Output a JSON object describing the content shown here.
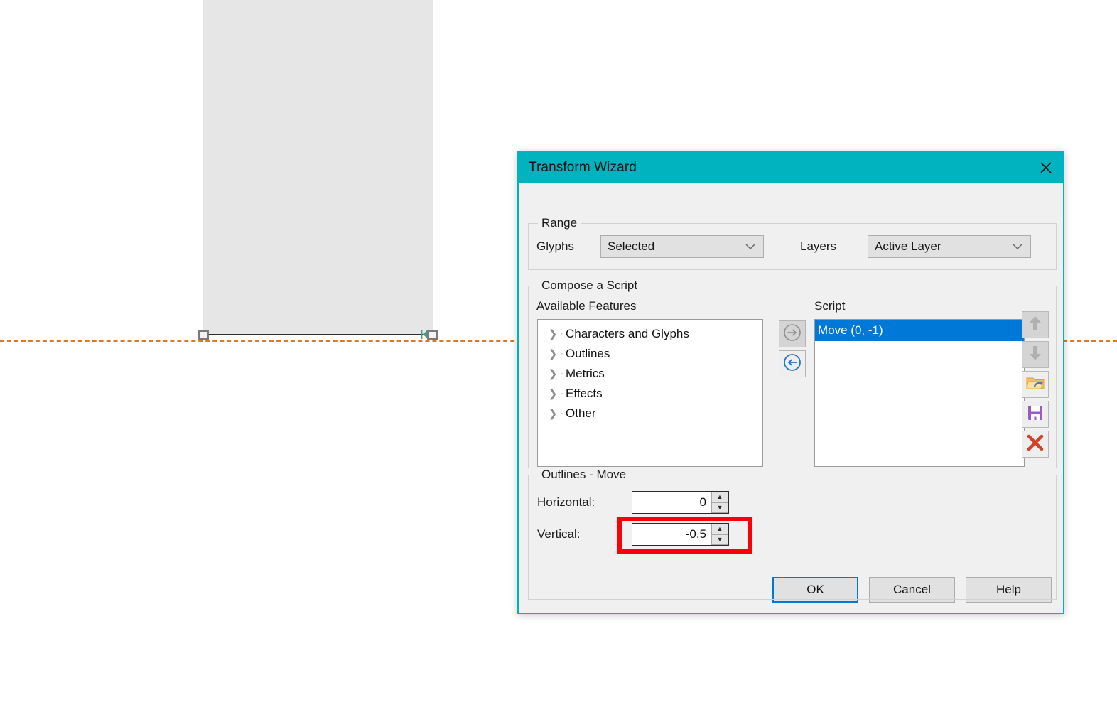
{
  "canvas": {
    "glyph_name": "glyph-outline-rectangle",
    "baseline_name": "baseline-guide",
    "nodes": [
      "node-bottom-left",
      "node-bottom-right"
    ],
    "colors": {
      "glyph_fill": "#e6e6e6",
      "glyph_stroke": "#2e2e2e",
      "baseline": "#e07820",
      "node_marker": "#4e9683"
    }
  },
  "dialog": {
    "title": "Transform Wizard",
    "close_label": "✕",
    "accent_color": "#00b3be",
    "range": {
      "group_title": "Range",
      "glyphs_label": "Glyphs",
      "glyphs_value": "Selected",
      "layers_label": "Layers",
      "layers_value": "Active Layer",
      "chevron": "⌄"
    },
    "compose": {
      "group_title": "Compose a Script",
      "available_label": "Available Features",
      "script_label": "Script",
      "features": [
        {
          "label": "Characters and Glyphs",
          "chevron": "❯"
        },
        {
          "label": "Outlines",
          "chevron": "❯"
        },
        {
          "label": "Metrics",
          "chevron": "❯"
        },
        {
          "label": "Effects",
          "chevron": "❯"
        },
        {
          "label": "Other",
          "chevron": "❯"
        }
      ],
      "script_items": [
        {
          "label": "Move (0, -1)",
          "selected": true
        }
      ],
      "transfer_right_icon": "arrow-right-circle-icon",
      "transfer_left_icon": "arrow-left-circle-icon",
      "side_buttons": [
        "move-up-icon",
        "move-down-icon",
        "open-folder-icon",
        "save-floppy-icon",
        "delete-x-icon"
      ]
    },
    "move": {
      "group_title": "Outlines - Move",
      "horizontal_label": "Horizontal:",
      "horizontal_value": "0",
      "vertical_label": "Vertical:",
      "vertical_value": "-0.5",
      "spin_up": "▲",
      "spin_down": "▼",
      "highlight_color": "#fa0007"
    },
    "footer": {
      "ok_label": "OK",
      "cancel_label": "Cancel",
      "help_label": "Help"
    }
  }
}
